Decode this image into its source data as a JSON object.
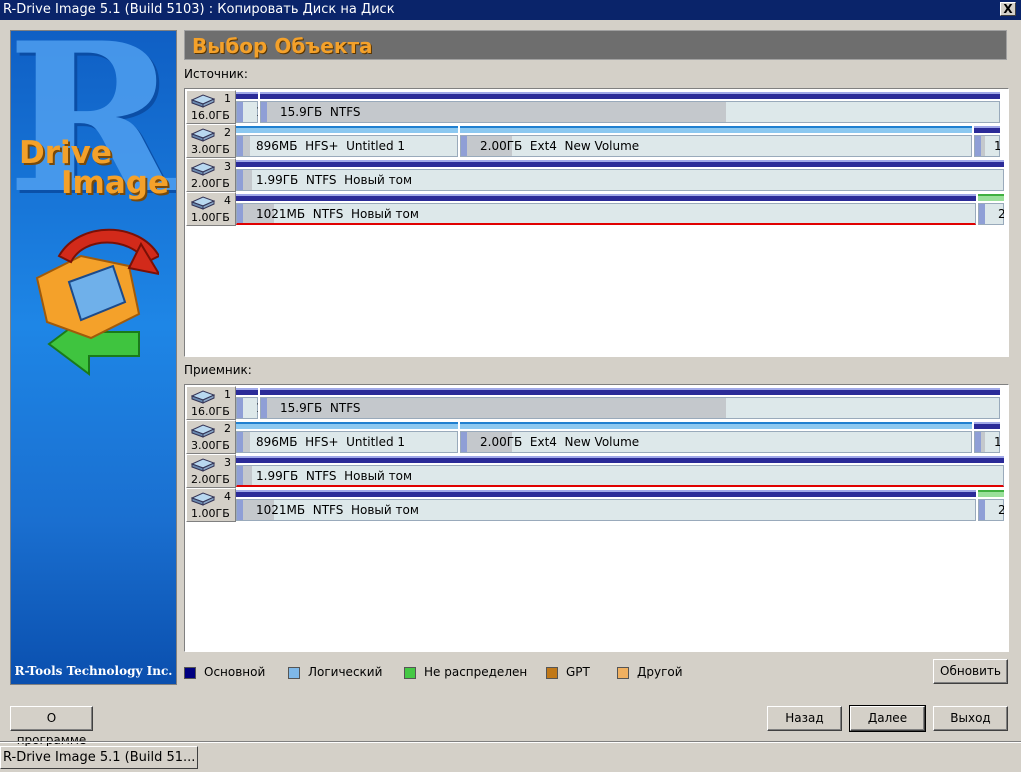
{
  "window": {
    "title": "R-Drive Image 5.1 (Build 5103) : Копировать Диск на Диск",
    "close_glyph": "X"
  },
  "sidebar": {
    "logo_letter": "R",
    "logo_word1": "Drive",
    "logo_word2": "Image",
    "company": "R-Tools Technology Inc."
  },
  "header": {
    "title": "Выбор Объекта"
  },
  "source": {
    "label": "Источник:",
    "disks": [
      {
        "num": "1",
        "size": "16.0ГБ",
        "partitions": [
          {
            "label": "1",
            "type": "primary",
            "used": 0.3
          },
          {
            "label": "15.9ГБ  NTFS",
            "type": "primary",
            "used": 0.63
          }
        ]
      },
      {
        "num": "2",
        "size": "3.00ГБ",
        "partitions": [
          {
            "label": "896МБ  HFS+  Untitled 1",
            "type": "logical",
            "used": 0.06
          },
          {
            "label": "2.00ГБ  Ext4  New Volume",
            "type": "logical",
            "used": 0.1
          },
          {
            "label": "1",
            "type": "primary",
            "used": 0.4
          }
        ]
      },
      {
        "num": "3",
        "size": "2.00ГБ",
        "partitions": [
          {
            "label": "1.99ГБ  NTFS  Новый том",
            "type": "primary",
            "used": 0.02
          }
        ]
      },
      {
        "num": "4",
        "size": "1.00ГБ",
        "partitions": [
          {
            "label": "1021МБ  NTFS  Новый том",
            "type": "primary",
            "used": 0.05,
            "selected": true
          },
          {
            "label": "2",
            "type": "unalloc",
            "used": 0.0
          }
        ]
      }
    ]
  },
  "target": {
    "label": "Приемник:",
    "disks": [
      {
        "num": "1",
        "size": "16.0ГБ",
        "partitions": [
          {
            "label": "1",
            "type": "primary",
            "used": 0.3
          },
          {
            "label": "15.9ГБ  NTFS",
            "type": "primary",
            "used": 0.63
          }
        ]
      },
      {
        "num": "2",
        "size": "3.00ГБ",
        "partitions": [
          {
            "label": "896МБ  HFS+  Untitled 1",
            "type": "logical",
            "used": 0.06
          },
          {
            "label": "2.00ГБ  Ext4  New Volume",
            "type": "logical",
            "used": 0.1
          },
          {
            "label": "1",
            "type": "primary",
            "used": 0.4
          }
        ]
      },
      {
        "num": "3",
        "size": "2.00ГБ",
        "partitions": [
          {
            "label": "1.99ГБ  NTFS  Новый том",
            "type": "primary",
            "used": 0.02,
            "selected": true
          }
        ]
      },
      {
        "num": "4",
        "size": "1.00ГБ",
        "partitions": [
          {
            "label": "1021МБ  NTFS  Новый том",
            "type": "primary",
            "used": 0.05
          },
          {
            "label": "2",
            "type": "unalloc",
            "used": 0.0
          }
        ]
      }
    ]
  },
  "legend": {
    "items": [
      {
        "label": "Основной",
        "color": "#000080"
      },
      {
        "label": "Логический",
        "color": "#7fb8e8"
      },
      {
        "label": "Не распределен",
        "color": "#44c844"
      },
      {
        "label": "GPT",
        "color": "#c07818"
      },
      {
        "label": "Другой",
        "color": "#f0b060"
      }
    ]
  },
  "buttons": {
    "refresh": "Обновить",
    "about": "О программе",
    "back": "Назад",
    "next": "Далее",
    "exit": "Выход"
  },
  "taskbar": {
    "label": "R-Drive Image 5.1 (Build 51..."
  }
}
